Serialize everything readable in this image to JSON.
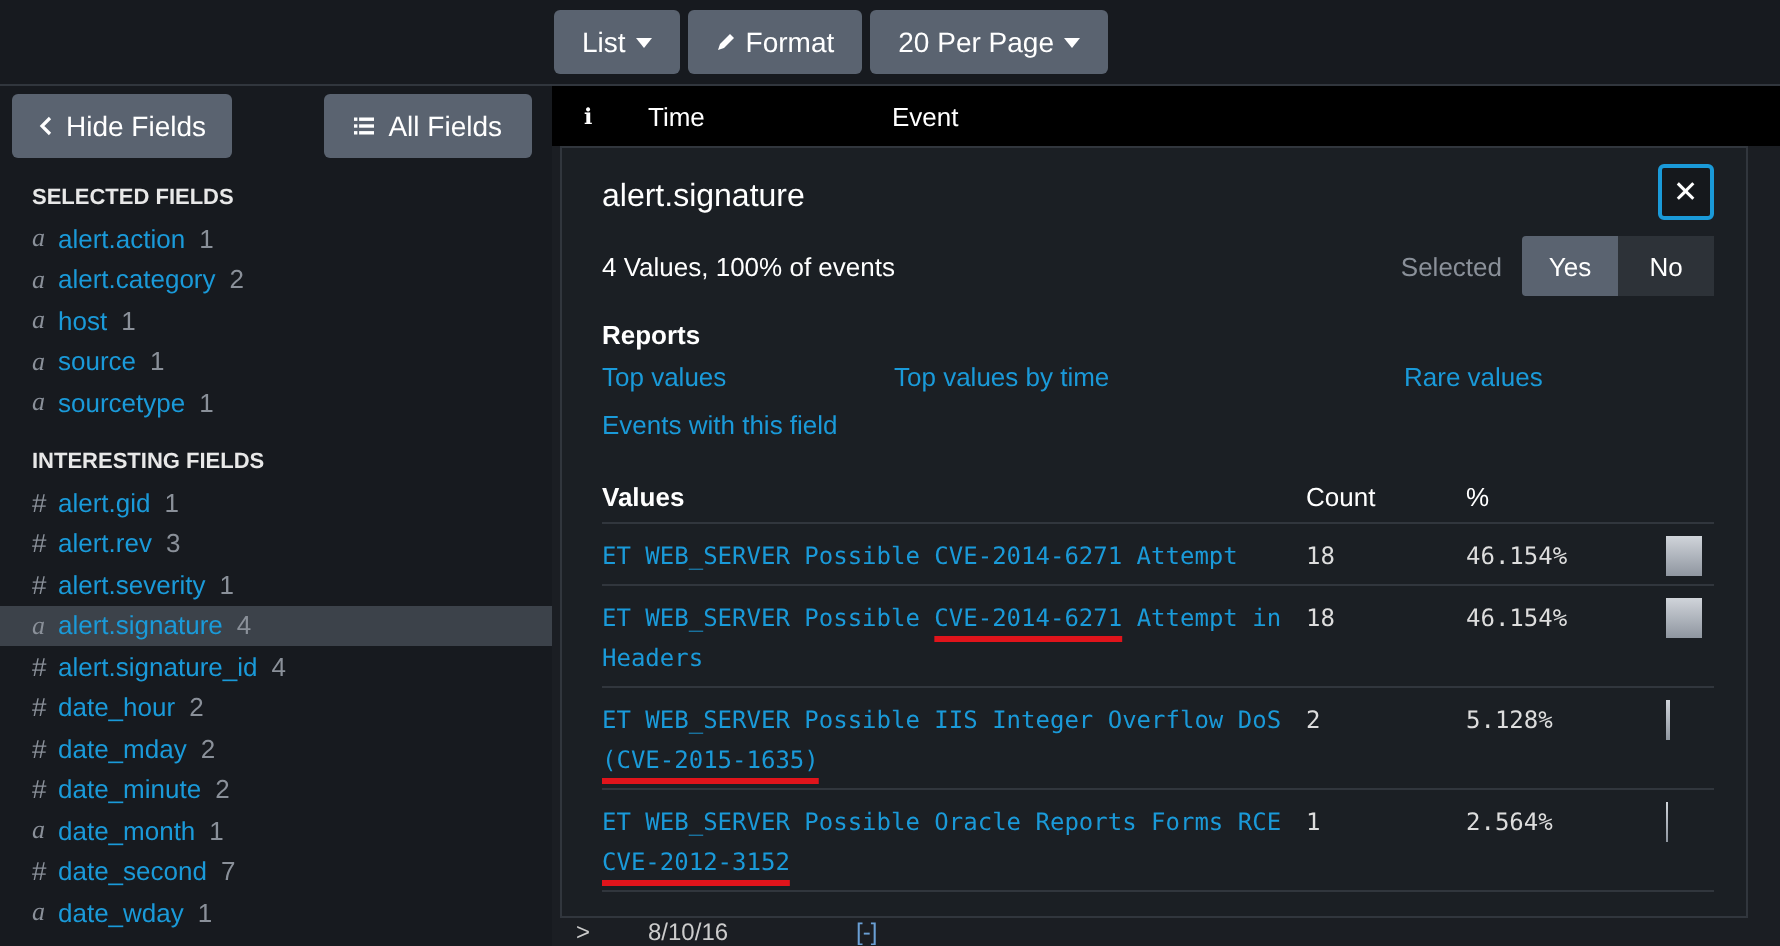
{
  "toolbar": {
    "buttons": [
      {
        "label": "List",
        "kind": "dropdown"
      },
      {
        "label": "Format",
        "kind": "edit"
      },
      {
        "label": "20 Per Page",
        "kind": "dropdown"
      }
    ]
  },
  "sidebar": {
    "hide_button": "Hide Fields",
    "all_button": "All Fields",
    "sections": [
      {
        "title": "SELECTED FIELDS",
        "fields": [
          {
            "type": "a",
            "name": "alert.action",
            "count": "1",
            "selected": false
          },
          {
            "type": "a",
            "name": "alert.category",
            "count": "2",
            "selected": false
          },
          {
            "type": "a",
            "name": "host",
            "count": "1",
            "selected": false
          },
          {
            "type": "a",
            "name": "source",
            "count": "1",
            "selected": false
          },
          {
            "type": "a",
            "name": "sourcetype",
            "count": "1",
            "selected": false
          }
        ]
      },
      {
        "title": "INTERESTING FIELDS",
        "fields": [
          {
            "type": "#",
            "name": "alert.gid",
            "count": "1",
            "selected": false
          },
          {
            "type": "#",
            "name": "alert.rev",
            "count": "3",
            "selected": false
          },
          {
            "type": "#",
            "name": "alert.severity",
            "count": "1",
            "selected": false
          },
          {
            "type": "a",
            "name": "alert.signature",
            "count": "4",
            "selected": true
          },
          {
            "type": "#",
            "name": "alert.signature_id",
            "count": "4",
            "selected": false
          },
          {
            "type": "#",
            "name": "date_hour",
            "count": "2",
            "selected": false
          },
          {
            "type": "#",
            "name": "date_mday",
            "count": "2",
            "selected": false
          },
          {
            "type": "#",
            "name": "date_minute",
            "count": "2",
            "selected": false
          },
          {
            "type": "a",
            "name": "date_month",
            "count": "1",
            "selected": false
          },
          {
            "type": "#",
            "name": "date_second",
            "count": "7",
            "selected": false
          },
          {
            "type": "a",
            "name": "date_wday",
            "count": "1",
            "selected": false
          }
        ]
      }
    ]
  },
  "table": {
    "info_icon": "i",
    "columns": [
      "Time",
      "Event"
    ],
    "row": {
      "expander": ">",
      "time": "8/10/16",
      "event": "[-]"
    }
  },
  "popup": {
    "title": "alert.signature",
    "close": "✕",
    "summary": "4 Values, 100% of events",
    "selected_label": "Selected",
    "selected_options": [
      {
        "label": "Yes",
        "selected": true
      },
      {
        "label": "No",
        "selected": false
      }
    ],
    "reports_heading": "Reports",
    "reports": [
      "Top values",
      "Top values by time",
      "Rare values",
      "Events with this field"
    ],
    "columns": [
      "Values",
      "Count",
      "%"
    ],
    "values": [
      {
        "before": "ET WEB_SERVER Possible CVE-2014-6271 Attempt",
        "count": "18",
        "percent": "46.154%"
      },
      {
        "before": "ET WEB_SERVER Possible ",
        "marked": "CVE-2014-6271",
        "after": " Attempt in Headers",
        "count": "18",
        "percent": "46.154%"
      },
      {
        "before": "ET WEB_SERVER Possible IIS Integer Overflow DoS ",
        "marked": "(CVE-2015-1635)",
        "count": "2",
        "percent": "5.128%"
      },
      {
        "before": "ET WEB_SERVER Possible Oracle Reports Forms RCE ",
        "marked": "CVE-2012-3152",
        "count": "1",
        "percent": "2.564%"
      }
    ]
  }
}
